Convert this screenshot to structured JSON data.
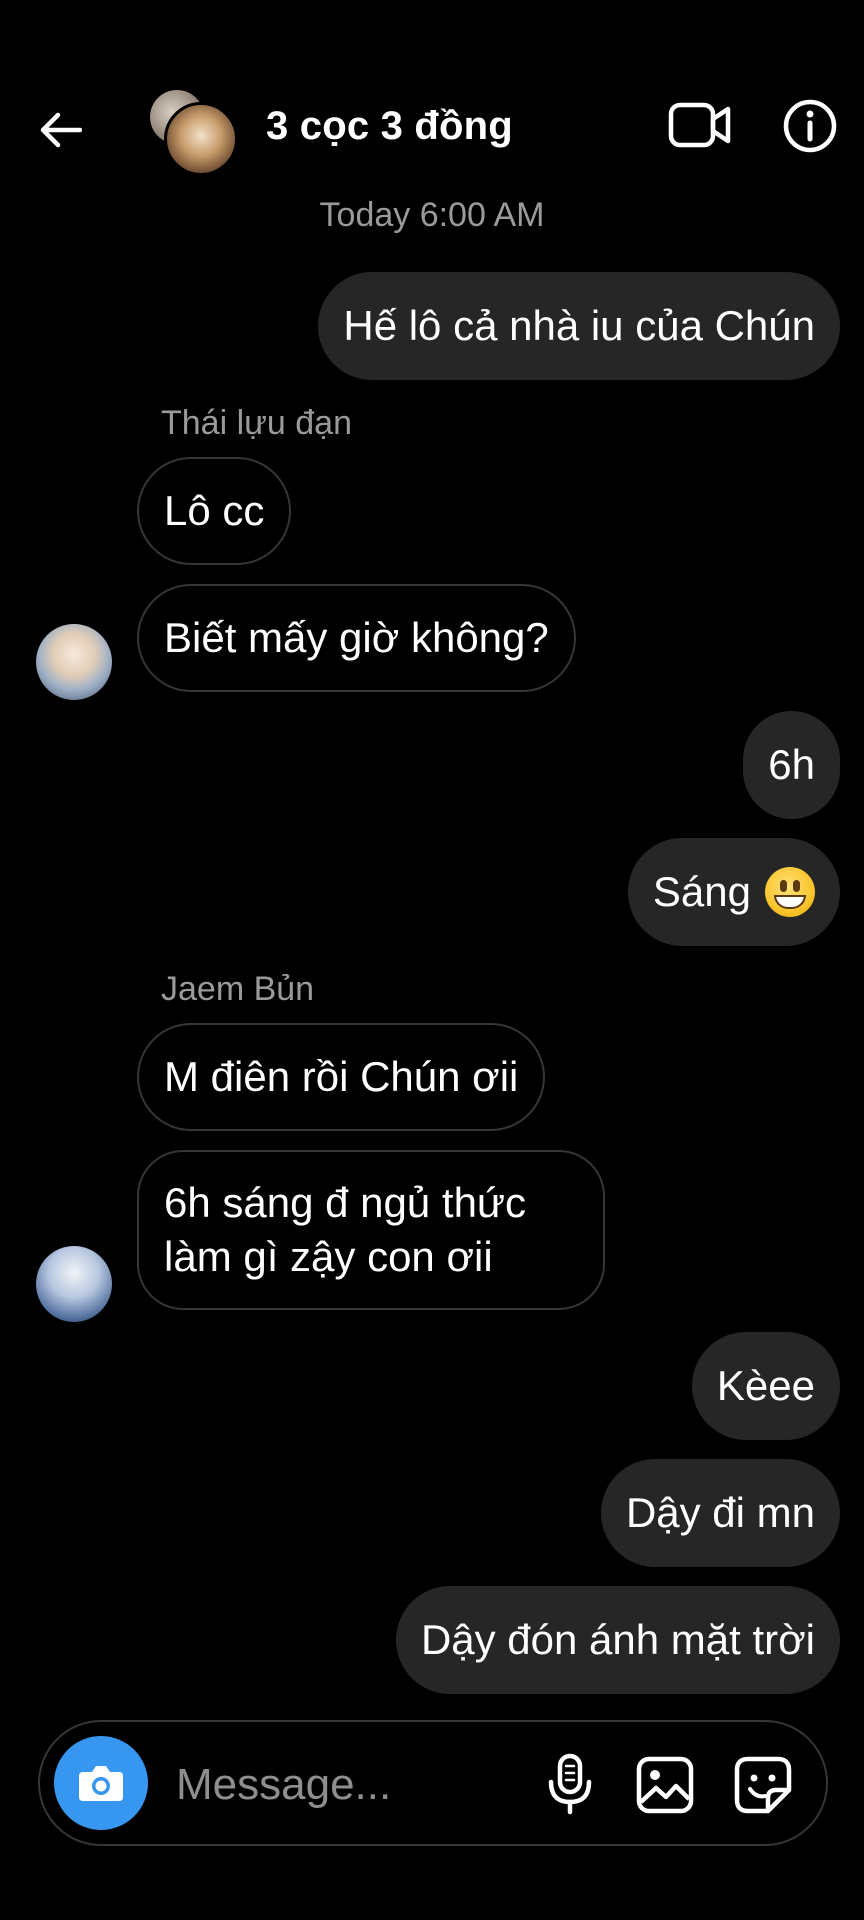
{
  "header": {
    "title": "3 cọc 3 đồng",
    "back_icon": "arrow-left-icon",
    "video_icon": "video-camera-icon",
    "info_icon": "info-icon"
  },
  "timestamp": "Today 6:00 AM",
  "messages": [
    {
      "direction": "out",
      "text": "Hế lô cả nhà iu của Chún"
    },
    {
      "direction": "in",
      "sender": "Thái lựu đạn",
      "text": "Lô cc"
    },
    {
      "direction": "in",
      "text": "Biết mấy giờ không?"
    },
    {
      "direction": "out",
      "text": "6h"
    },
    {
      "direction": "out",
      "text": "Sáng",
      "emoji": "grinning-face-emoji"
    },
    {
      "direction": "in",
      "sender": "Jaem Bủn",
      "text": "M điên rồi Chún ơii"
    },
    {
      "direction": "in",
      "text": "6h sáng đ ngủ thức làm gì zậy con ơii"
    },
    {
      "direction": "out",
      "text": "Kèee"
    },
    {
      "direction": "out",
      "text": "Dậy đi mn"
    },
    {
      "direction": "out",
      "text": "Dậy đón ánh mặt trời"
    }
  ],
  "composer": {
    "placeholder": "Message...",
    "value": "",
    "camera_icon": "camera-icon",
    "mic_icon": "microphone-icon",
    "gallery_icon": "image-icon",
    "sticker_icon": "sticker-icon"
  },
  "colors": {
    "background": "#000000",
    "outgoing_bubble": "#262626",
    "incoming_border": "#363636",
    "camera_button": "#3797f0",
    "secondary_text": "#9a9a9a"
  }
}
